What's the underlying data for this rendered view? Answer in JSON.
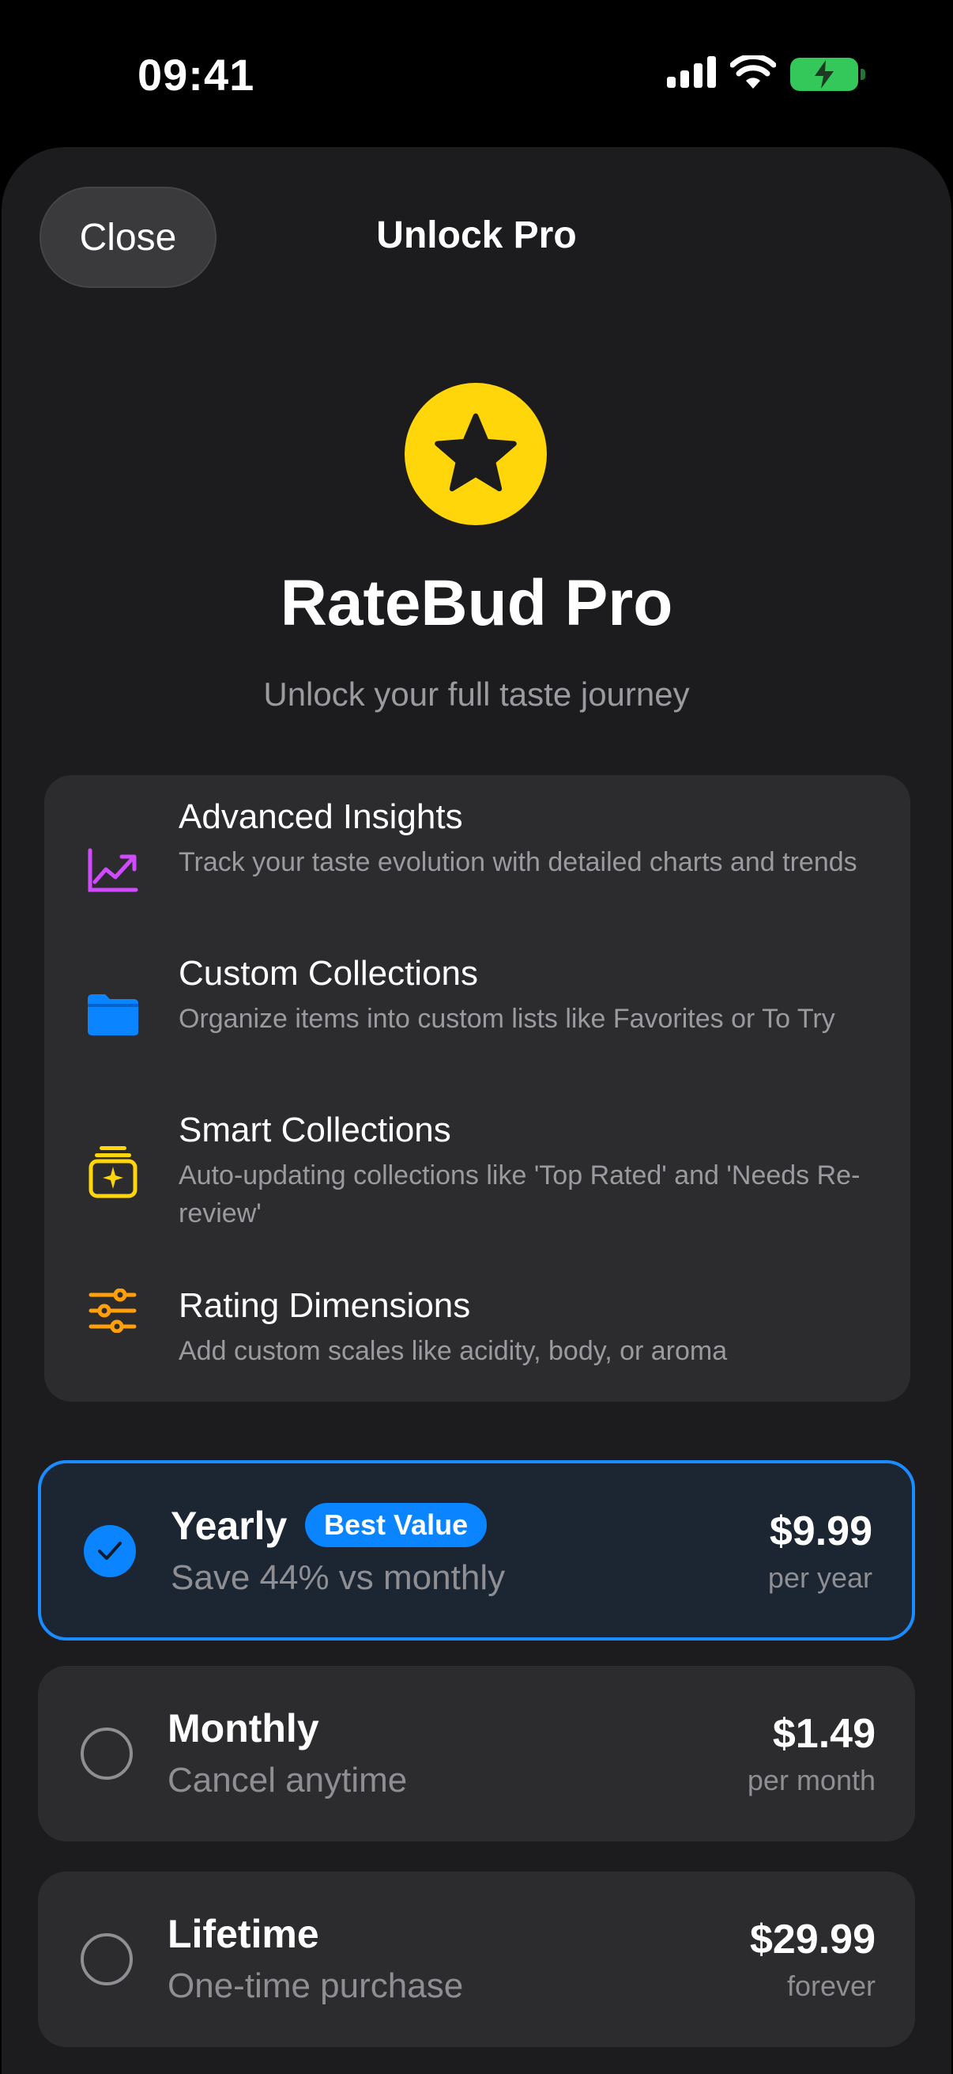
{
  "status": {
    "time": "09:41"
  },
  "header": {
    "close_label": "Close",
    "title": "Unlock Pro"
  },
  "hero": {
    "product_name": "RateBud Pro",
    "tagline": "Unlock your full taste journey",
    "icon": "star-icon"
  },
  "features": [
    {
      "icon": "chart-line-icon",
      "title": "Advanced Insights",
      "desc": "Track your taste evolution with detailed charts and trends",
      "color": "#d04bff"
    },
    {
      "icon": "folder-icon",
      "title": "Custom Collections",
      "desc": "Organize items into custom lists like Favorites or To Try",
      "color": "#0a84ff"
    },
    {
      "icon": "sparkle-stack-icon",
      "title": "Smart Collections",
      "desc": "Auto-updating collections like 'Top Rated' and 'Needs Re-review'",
      "color": "#ffd60a"
    },
    {
      "icon": "sliders-icon",
      "title": "Rating Dimensions",
      "desc": "Add custom scales like acidity, body, or aroma",
      "color": "#ff9f0a"
    }
  ],
  "plans": [
    {
      "name": "Yearly",
      "badge": "Best Value",
      "subtitle": "Save 44% vs monthly",
      "price": "$9.99",
      "period": "per year",
      "selected": true
    },
    {
      "name": "Monthly",
      "subtitle": "Cancel anytime",
      "price": "$1.49",
      "period": "per month",
      "selected": false
    },
    {
      "name": "Lifetime",
      "subtitle": "One-time purchase",
      "price": "$29.99",
      "period": "forever",
      "selected": false
    }
  ],
  "colors": {
    "accent": "#0a84ff",
    "brand": "#ffd60a",
    "background": "#1c1c1e",
    "card": "#2c2c2e"
  }
}
